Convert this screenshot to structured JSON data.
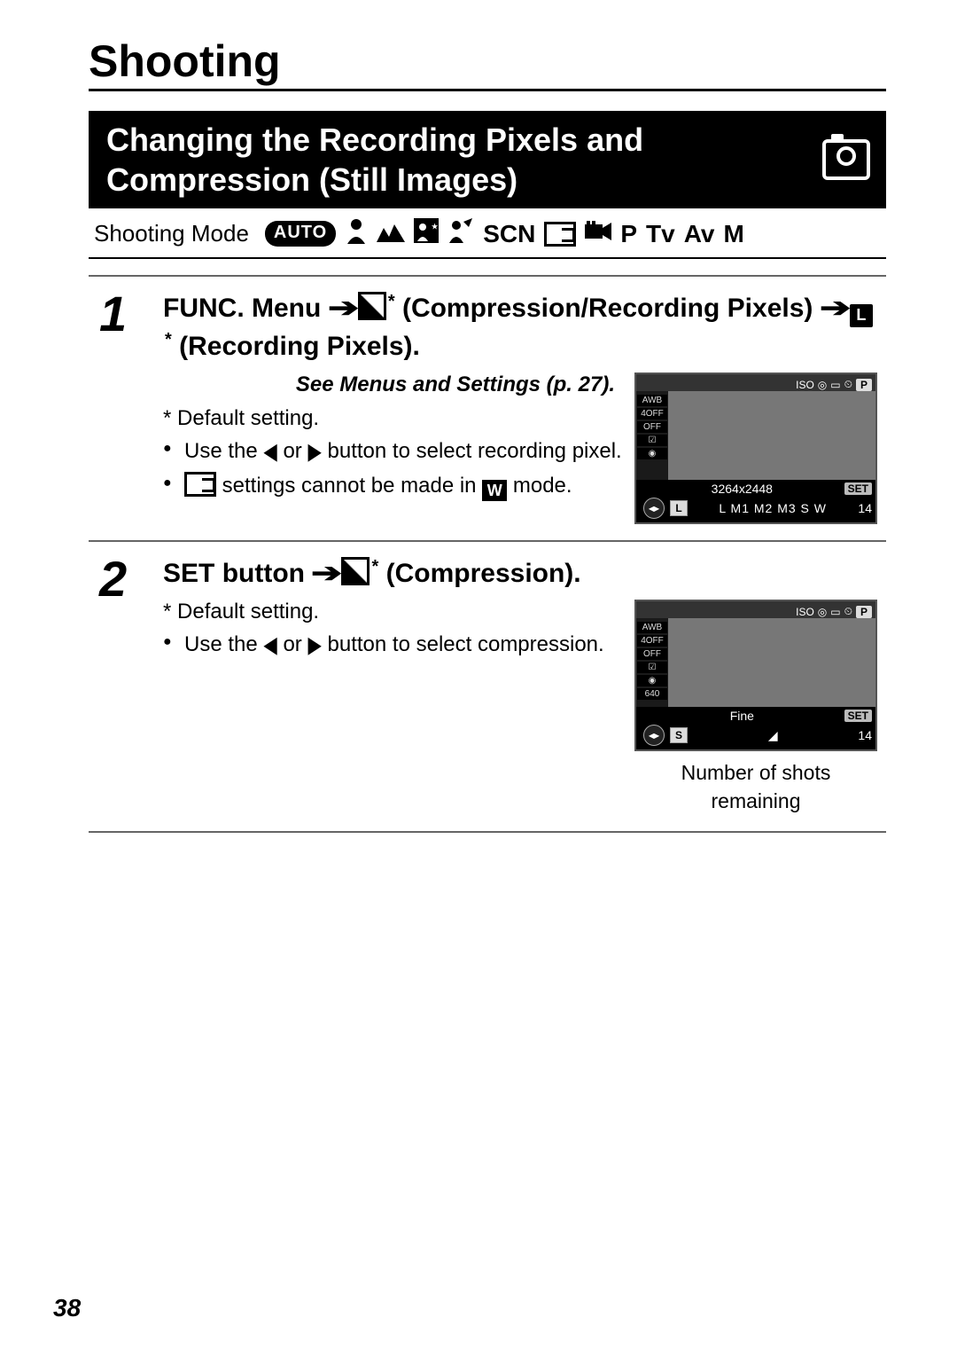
{
  "chapter": {
    "title": "Shooting"
  },
  "section": {
    "title": "Changing the Recording Pixels and Compression (Still Images)"
  },
  "modebar": {
    "label": "Shooting Mode",
    "autoPill": "AUTO",
    "scn": "SCN",
    "p": "P",
    "tv": "Tv",
    "av": "Av",
    "m": "M"
  },
  "step1": {
    "num": "1",
    "head_func": "FUNC. Menu",
    "head_part1": " (Compression/Recording Pixels)",
    "head_L": "L",
    "head_part2": " (Recording Pixels).",
    "ref": "See Menus and Settings (p. 27).",
    "default": "* Default setting.",
    "bullet1a": "Use the ",
    "bullet1b": " or ",
    "bullet1c": " button to select recording pixel.",
    "bullet2a": " settings cannot be made in ",
    "bullet2b": " mode."
  },
  "lcd1": {
    "side": [
      "AWB",
      "4OFF",
      "OFF",
      "☑",
      "◉"
    ],
    "res": "3264x2448",
    "set": "SET",
    "opts": "L  M1 M2 M3  S  W",
    "shots": "14"
  },
  "step2": {
    "num": "2",
    "head_set": "SET",
    "head_btn": " button",
    "head_comp": " (Compression).",
    "default": "* Default setting.",
    "bullet1a": "Use the ",
    "bullet1b": " or ",
    "bullet1c": " button to select compression."
  },
  "lcd2": {
    "side": [
      "AWB",
      "4OFF",
      "OFF",
      "☑",
      "◉",
      "640"
    ],
    "label": "Fine",
    "set": "SET",
    "shots": "14",
    "captionA": "Number of shots",
    "captionB": "remaining"
  },
  "pageNumber": "38"
}
